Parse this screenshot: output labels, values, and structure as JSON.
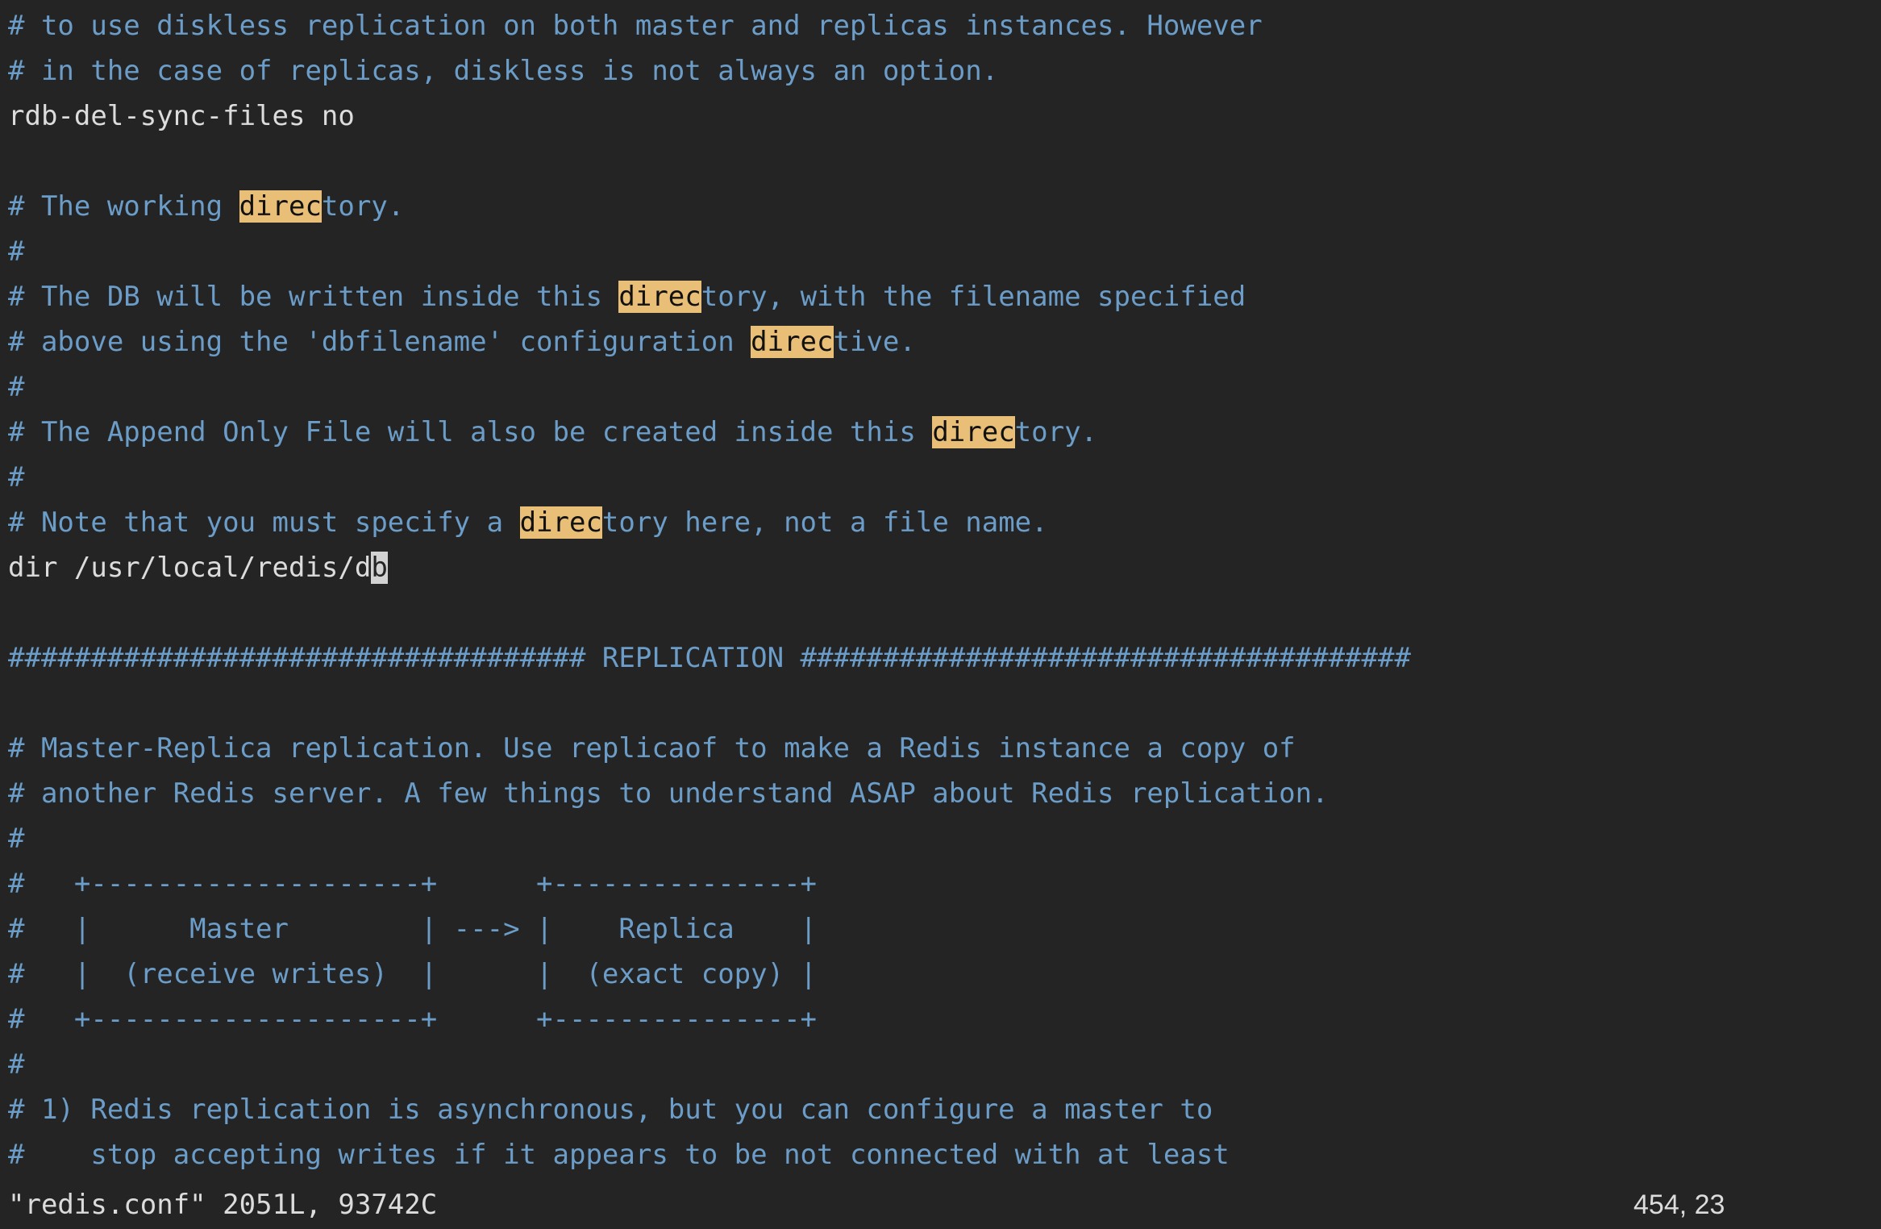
{
  "terminal": {
    "background_color": "#242424",
    "comment_color": "#6b9dc8",
    "code_color": "#dcdcdc",
    "search_highlight_bg": "#e9bf77",
    "search_highlight_fg": "#111111",
    "cursor_bg": "#d2d2d2",
    "search_term": "direc"
  },
  "buffer": {
    "lines": [
      {
        "type": "comment",
        "segments": [
          {
            "text": "# to use diskless replication on both master and replicas instances. However"
          }
        ]
      },
      {
        "type": "comment",
        "segments": [
          {
            "text": "# in the case of replicas, diskless is not always an option."
          }
        ]
      },
      {
        "type": "code",
        "segments": [
          {
            "text": "rdb-del-sync-files no"
          }
        ]
      },
      {
        "type": "blank",
        "segments": [
          {
            "text": ""
          }
        ]
      },
      {
        "type": "comment",
        "segments": [
          {
            "text": "# The working "
          },
          {
            "text": "direc",
            "style": "hl"
          },
          {
            "text": "tory."
          }
        ]
      },
      {
        "type": "comment",
        "segments": [
          {
            "text": "#"
          }
        ]
      },
      {
        "type": "comment",
        "segments": [
          {
            "text": "# The DB will be written inside this "
          },
          {
            "text": "direc",
            "style": "hl"
          },
          {
            "text": "tory, with the filename specified"
          }
        ]
      },
      {
        "type": "comment",
        "segments": [
          {
            "text": "# above using the 'dbfilename' configuration "
          },
          {
            "text": "direc",
            "style": "hl"
          },
          {
            "text": "tive."
          }
        ]
      },
      {
        "type": "comment",
        "segments": [
          {
            "text": "#"
          }
        ]
      },
      {
        "type": "comment",
        "segments": [
          {
            "text": "# The Append Only File will also be created inside this "
          },
          {
            "text": "direc",
            "style": "hl"
          },
          {
            "text": "tory."
          }
        ]
      },
      {
        "type": "comment",
        "segments": [
          {
            "text": "#"
          }
        ]
      },
      {
        "type": "comment",
        "segments": [
          {
            "text": "# Note that you must specify a "
          },
          {
            "text": "direc",
            "style": "hl"
          },
          {
            "text": "tory here, not a file name."
          }
        ]
      },
      {
        "type": "code",
        "segments": [
          {
            "text": "dir /usr/local/redis/d"
          },
          {
            "text": "b",
            "style": "cursor"
          }
        ]
      },
      {
        "type": "blank",
        "segments": [
          {
            "text": ""
          }
        ]
      },
      {
        "type": "comment",
        "segments": [
          {
            "text": "################################### REPLICATION #####################################"
          }
        ]
      },
      {
        "type": "blank",
        "segments": [
          {
            "text": ""
          }
        ]
      },
      {
        "type": "comment",
        "segments": [
          {
            "text": "# Master-Replica replication. Use replicaof to make a Redis instance a copy of"
          }
        ]
      },
      {
        "type": "comment",
        "segments": [
          {
            "text": "# another Redis server. A few things to understand ASAP about Redis replication."
          }
        ]
      },
      {
        "type": "comment",
        "segments": [
          {
            "text": "#"
          }
        ]
      },
      {
        "type": "comment",
        "segments": [
          {
            "text": "#   +--------------------+      +---------------+"
          }
        ]
      },
      {
        "type": "comment",
        "segments": [
          {
            "text": "#   |      Master        | ---> |    Replica    |"
          }
        ]
      },
      {
        "type": "comment",
        "segments": [
          {
            "text": "#   |  (receive writes)  |      |  (exact copy) |"
          }
        ]
      },
      {
        "type": "comment",
        "segments": [
          {
            "text": "#   +--------------------+      +---------------+"
          }
        ]
      },
      {
        "type": "comment",
        "segments": [
          {
            "text": "#"
          }
        ]
      },
      {
        "type": "comment",
        "segments": [
          {
            "text": "# 1) Redis replication is asynchronous, but you can configure a master to"
          }
        ]
      },
      {
        "type": "comment",
        "segments": [
          {
            "text": "#    stop accepting writes if it appears to be not connected with at least"
          }
        ]
      }
    ]
  },
  "statusline": {
    "file_info": "\"redis.conf\" 2051L, 93742C",
    "position": "454, 23"
  }
}
